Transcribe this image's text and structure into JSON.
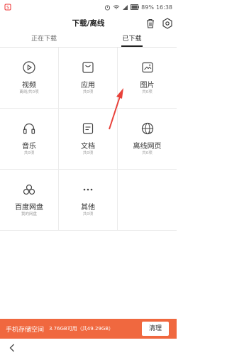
{
  "statusbar": {
    "battery": "89%",
    "time": "16:38"
  },
  "header": {
    "title": "下载/离线"
  },
  "tabs": [
    {
      "label": "正在下载",
      "active": false
    },
    {
      "label": "已下载",
      "active": true
    }
  ],
  "categories": [
    {
      "name": "视频",
      "sub": "离线/共0项",
      "icon": "play-icon"
    },
    {
      "name": "应用",
      "sub": "共0项",
      "icon": "bag-icon"
    },
    {
      "name": "图片",
      "sub": "共0项",
      "icon": "picture-icon"
    },
    {
      "name": "音乐",
      "sub": "共0项",
      "icon": "headphones-icon"
    },
    {
      "name": "文档",
      "sub": "共0项",
      "icon": "document-icon"
    },
    {
      "name": "离线网页",
      "sub": "共0项",
      "icon": "globe-download-icon"
    },
    {
      "name": "百度网盘",
      "sub": "我的网盘",
      "icon": "cloud-icon"
    },
    {
      "name": "其他",
      "sub": "共0项",
      "icon": "more-icon"
    }
  ],
  "storage": {
    "label": "手机存储空间",
    "size": "3.76GB可用（共49.29GB）",
    "clean_label": "清理"
  },
  "colors": {
    "accent": "#f0683f"
  }
}
